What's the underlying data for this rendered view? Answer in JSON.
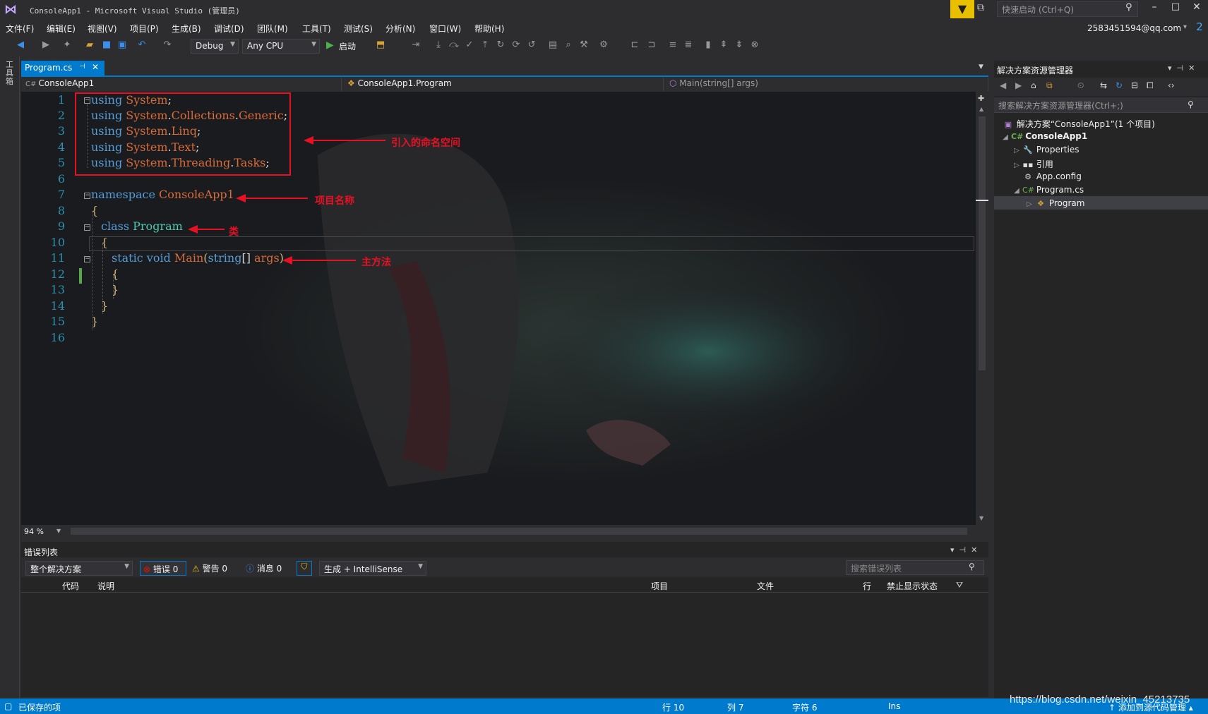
{
  "window": {
    "title": "ConsoleApp1 - Microsoft Visual Studio (管理员)",
    "quick_launch_placeholder": "快速启动 (Ctrl+Q)",
    "account": "2583451594@qq.com",
    "notifications": "2"
  },
  "menu": [
    "文件(F)",
    "编辑(E)",
    "视图(V)",
    "项目(P)",
    "生成(B)",
    "调试(D)",
    "团队(M)",
    "工具(T)",
    "测试(S)",
    "分析(N)",
    "窗口(W)",
    "帮助(H)"
  ],
  "toolbar": {
    "configuration": "Debug",
    "platform": "Any CPU",
    "start_label": "启动"
  },
  "toolbox_label": "工具箱",
  "editor": {
    "tab_name": "Program.cs",
    "nav_project": "ConsoleApp1",
    "nav_class": "ConsoleApp1.Program",
    "nav_member": "Main(string[] args)",
    "zoom": "94 %",
    "line_numbers": [
      "1",
      "2",
      "3",
      "4",
      "5",
      "6",
      "7",
      "8",
      "9",
      "10",
      "11",
      "12",
      "13",
      "14",
      "15",
      "16"
    ],
    "code": {
      "using_kw": "using",
      "u1": "System",
      "u2a": "System",
      "u2b": "Collections",
      "u2c": "Generic",
      "u3a": "System",
      "u3b": "Linq",
      "u4a": "System",
      "u4b": "Text",
      "u5a": "System",
      "u5b": "Threading",
      "u5c": "Tasks",
      "namespace_kw": "namespace",
      "namespace_name": "ConsoleApp1",
      "class_kw": "class",
      "class_name": "Program",
      "static_kw": "static",
      "void_kw": "void",
      "method_name": "Main",
      "string_kw": "string",
      "param_name": "args"
    }
  },
  "annotations": {
    "namespaces": "引入的命名空间",
    "project_name": "项目名称",
    "class": "类",
    "main_method": "主方法"
  },
  "error_list": {
    "title": "错误列表",
    "scope": "整个解决方案",
    "errors": "错误 0",
    "warnings": "警告 0",
    "messages": "消息 0",
    "source": "生成 + IntelliSense",
    "search_placeholder": "搜索错误列表",
    "columns": [
      "代码",
      "说明",
      "项目",
      "文件",
      "行",
      "禁止显示状态"
    ]
  },
  "solution_explorer": {
    "title": "解决方案资源管理器",
    "search_placeholder": "搜索解决方案资源管理器(Ctrl+;)",
    "solution": "解决方案“ConsoleApp1”(1 个项目)",
    "project": "ConsoleApp1",
    "items": [
      "Properties",
      "引用",
      "App.config",
      "Program.cs",
      "Program"
    ]
  },
  "status": {
    "saved": "已保存的项",
    "line": "行 10",
    "col": "列 7",
    "char": "字符 6",
    "ins": "Ins",
    "source_control": "添加到源代码管理"
  },
  "watermark": "https://blog.csdn.net/weixin_45213735"
}
